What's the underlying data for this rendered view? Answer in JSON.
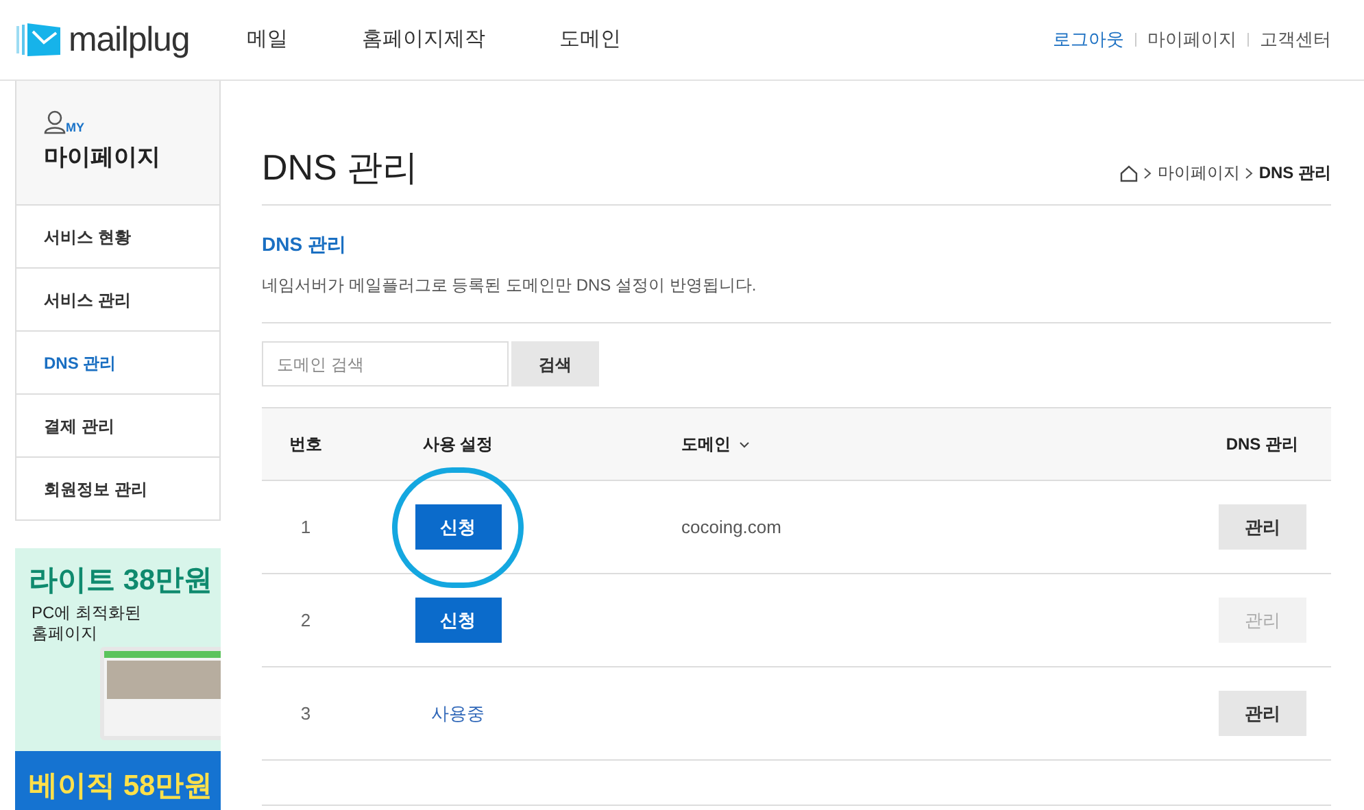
{
  "header": {
    "logo": "mailplug",
    "nav": [
      "메일",
      "홈페이지제작",
      "도메인"
    ],
    "util_links": [
      {
        "label": "로그아웃",
        "kind": "accent"
      },
      {
        "label": "마이페이지",
        "kind": "plain"
      },
      {
        "label": "고객센터",
        "kind": "plain"
      }
    ]
  },
  "sidebar": {
    "badge": "MY",
    "title": "마이페이지",
    "items": [
      {
        "label": "서비스 현황",
        "selected": false
      },
      {
        "label": "서비스 관리",
        "selected": false
      },
      {
        "label": "DNS 관리",
        "selected": true
      },
      {
        "label": "결제 관리",
        "selected": false
      },
      {
        "label": "회원정보 관리",
        "selected": false
      }
    ],
    "banner": {
      "headline": "라이트 38만원",
      "subline": "PC에 최적화된",
      "subline2": "홈페이지",
      "headline2": "베이직 58만원"
    }
  },
  "page": {
    "title": "DNS 관리",
    "breadcrumb": [
      "마이페이지",
      "DNS 관리"
    ],
    "section_title": "DNS 관리",
    "description": "네임서버가 메일플러그로 등록된 도메인만 DNS 설정이 반영됩니다.",
    "search": {
      "placeholder": "도메인 검색",
      "button": "검색"
    },
    "table": {
      "columns": [
        "번호",
        "사용 설정",
        "도메인",
        "DNS 관리"
      ],
      "rows": [
        {
          "number": "1",
          "setting": {
            "kind": "button",
            "label": "신청"
          },
          "domain": "cocoing.com",
          "manage": {
            "label": "관리",
            "disabled": false
          },
          "circled": true
        },
        {
          "number": "2",
          "setting": {
            "kind": "button",
            "label": "신청"
          },
          "domain": "",
          "manage": {
            "label": "관리",
            "disabled": true
          },
          "circled": false
        },
        {
          "number": "3",
          "setting": {
            "kind": "status",
            "label": "사용중"
          },
          "domain": "",
          "manage": {
            "label": "관리",
            "disabled": false
          },
          "circled": false
        }
      ]
    }
  }
}
